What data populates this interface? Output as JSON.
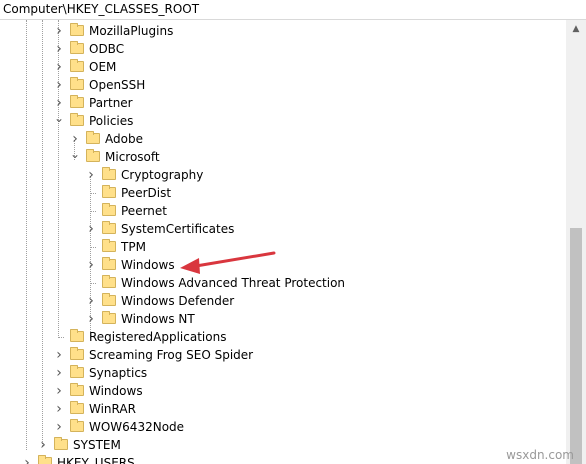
{
  "address": "Computer\\HKEY_CLASSES_ROOT",
  "tree": {
    "rows": [
      {
        "label": "MozillaPlugins",
        "level": 1,
        "chevron": "right"
      },
      {
        "label": "ODBC",
        "level": 1,
        "chevron": "right"
      },
      {
        "label": "OEM",
        "level": 1,
        "chevron": "right"
      },
      {
        "label": "OpenSSH",
        "level": 1,
        "chevron": "right"
      },
      {
        "label": "Partner",
        "level": 1,
        "chevron": "right"
      },
      {
        "label": "Policies",
        "level": 1,
        "chevron": "down"
      },
      {
        "label": "Adobe",
        "level": 2,
        "chevron": "right"
      },
      {
        "label": "Microsoft",
        "level": 2,
        "chevron": "down"
      },
      {
        "label": "Cryptography",
        "level": 3,
        "chevron": "right"
      },
      {
        "label": "PeerDist",
        "level": 3,
        "chevron": "none"
      },
      {
        "label": "Peernet",
        "level": 3,
        "chevron": "none"
      },
      {
        "label": "SystemCertificates",
        "level": 3,
        "chevron": "right"
      },
      {
        "label": "TPM",
        "level": 3,
        "chevron": "none"
      },
      {
        "label": "Windows",
        "level": 3,
        "chevron": "right"
      },
      {
        "label": "Windows Advanced Threat Protection",
        "level": 3,
        "chevron": "none"
      },
      {
        "label": "Windows Defender",
        "level": 3,
        "chevron": "right"
      },
      {
        "label": "Windows NT",
        "level": 3,
        "chevron": "right"
      },
      {
        "label": "RegisteredApplications",
        "level": 1,
        "chevron": "none"
      },
      {
        "label": "Screaming Frog SEO Spider",
        "level": 1,
        "chevron": "right"
      },
      {
        "label": "Synaptics",
        "level": 1,
        "chevron": "right"
      },
      {
        "label": "Windows",
        "level": 1,
        "chevron": "right"
      },
      {
        "label": "WinRAR",
        "level": 1,
        "chevron": "right"
      },
      {
        "label": "WOW6432Node",
        "level": 1,
        "chevron": "right"
      },
      {
        "label": "SYSTEM",
        "level": 0,
        "chevron": "right"
      },
      {
        "label": "HKEY_USERS",
        "level": -1,
        "chevron": "right"
      }
    ]
  },
  "annotation": {
    "color": "#d9363e"
  },
  "watermark": "wsxdn.com",
  "icons": {
    "folder": "folder-icon",
    "expand": "chevron-right-icon",
    "collapse": "chevron-down-icon"
  }
}
